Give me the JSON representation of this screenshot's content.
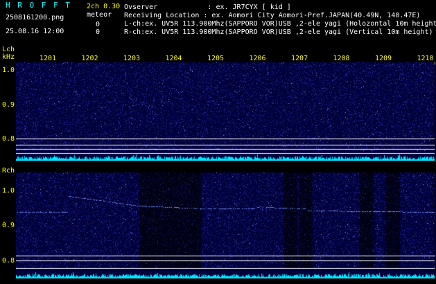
{
  "header": {
    "logo": "H R O F F T",
    "filename": "2508161200.png",
    "datetime": "25.08.16 12:00",
    "channels_label": "2ch 0.30",
    "meteor_label": "meteor",
    "count_l": "0",
    "count_r": "0",
    "observer_line": "Ovserver            : ex. JR7CYX [ kid ]",
    "location_line": "Receiving Location : ex. Aomori City Aomori-Pref.JAPAN(40.49N, 140.47E)",
    "lch_line": "L-ch:ex. UV5R 113.900Mhz(SAPPORO VOR)USB ,2-ele yagi (Holozontal 10m height)",
    "rch_line": "R-ch:ex. UV5R 113.900Mhz(SAPPORO VOR)USB ,2-ele yagi (Vertical 10m height)"
  },
  "time_ticks": [
    "1201",
    "1202",
    "1203",
    "1204",
    "1205",
    "1206",
    "1207",
    "1208",
    "1209",
    "1210"
  ],
  "lch_panel": {
    "label": "Lch",
    "unit": "kHz",
    "y_ticks": [
      "1.0",
      "0.9",
      "0.8"
    ]
  },
  "rch_panel": {
    "label": "Rch",
    "y_ticks": [
      "1.0",
      "0.9",
      "0.8"
    ]
  },
  "colors": {
    "background": "#000000",
    "spectrogram_bg": "#00003a",
    "noise_floor": "#00e5ff",
    "label_yellow": "#ffff00",
    "label_cyan": "#00ffff"
  }
}
